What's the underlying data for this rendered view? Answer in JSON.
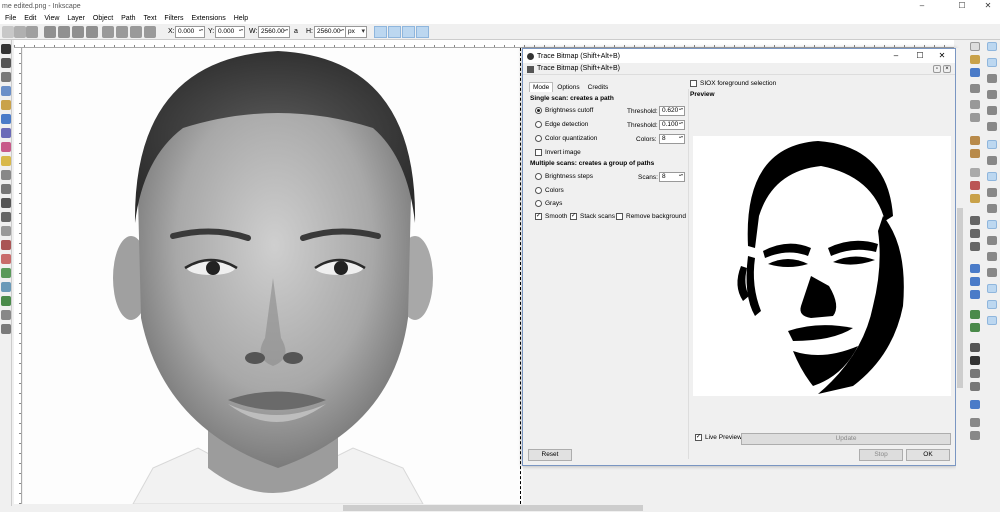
{
  "window": {
    "title": "me edited.png - Inkscape",
    "minimize": "–",
    "maximize": "☐",
    "close": "✕"
  },
  "menu": [
    "File",
    "Edit",
    "View",
    "Layer",
    "Object",
    "Path",
    "Text",
    "Filters",
    "Extensions",
    "Help"
  ],
  "toolbar": {
    "x_label": "X:",
    "x_value": "0.000",
    "y_label": "Y:",
    "y_value": "0.000",
    "w_label": "W:",
    "w_value": "2560.00",
    "lock_icon": "a",
    "h_label": "H:",
    "h_value": "2560.00",
    "unit": "px"
  },
  "dialog": {
    "title": "Trace Bitmap (Shift+Alt+B)",
    "subtitle": "Trace Bitmap (Shift+Alt+B)",
    "min": "–",
    "max": "☐",
    "close": "✕",
    "tabs": [
      "Mode",
      "Options",
      "Credits"
    ],
    "single_scan": "Single scan: creates a path",
    "brightness_cutoff": "Brightness cutoff",
    "threshold_label": "Threshold:",
    "threshold_value": "0.620",
    "edge_detection": "Edge detection",
    "edge_threshold_label": "Threshold:",
    "edge_threshold_value": "0.100",
    "color_quant": "Color quantization",
    "colors_label": "Colors:",
    "colors_value": "8",
    "invert_image": "Invert image",
    "multiple_scans": "Multiple scans: creates a group of paths",
    "brightness_steps": "Brightness steps",
    "scans_label": "Scans:",
    "scans_value": "8",
    "colors_opt": "Colors",
    "grays_opt": "Grays",
    "smooth": "Smooth",
    "stack_scans": "Stack scans",
    "remove_background": "Remove background",
    "siox": "SIOX foreground selection",
    "preview_title": "Preview",
    "live_preview": "Live Preview",
    "update": "Update",
    "reset": "Reset",
    "stop": "Stop",
    "ok": "OK"
  },
  "colors": {
    "accent": "#bcd7f0",
    "dialog_border": "#7a96c2"
  }
}
